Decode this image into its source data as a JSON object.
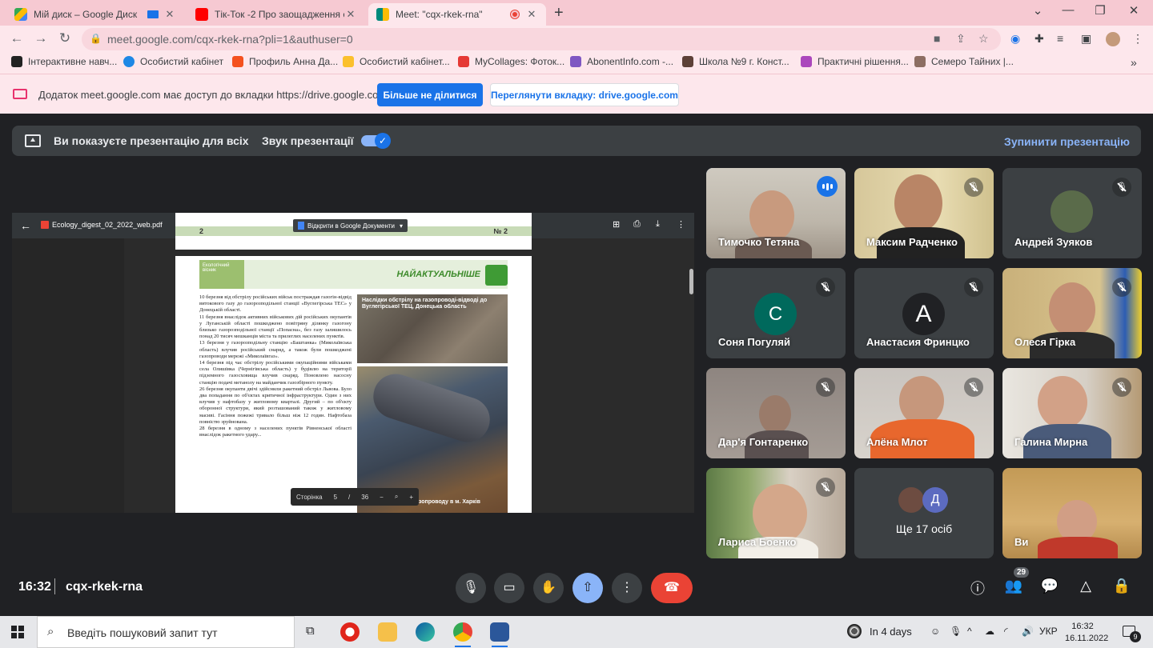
{
  "browser": {
    "tabs": [
      {
        "title": "Мій диск – Google Диск",
        "color": "#4285f4"
      },
      {
        "title": "Tік-Ток -2 Про заощадження ел",
        "color": "#ff0000"
      },
      {
        "title": "Meet: \"cqx-rkek-rna\"",
        "color": "#00897b"
      }
    ],
    "url": "meet.google.com/cqx-rkek-rna?pli=1&authuser=0",
    "bookmarks": [
      "Інтерактивне навч...",
      "Особистий кабінет",
      "Профиль Анна Да...",
      "Особистий кабінет...",
      "MyCollages: Фоток...",
      "AbonentInfo.com -...",
      "Школа №9 г. Конст...",
      "Практичні рішення...",
      "Семеро Тайних |..."
    ]
  },
  "infobar": {
    "message": "Додаток meet.google.com має доступ до вкладки https://drive.google.com",
    "stop_label": "Більше не ділитися",
    "view_label": "Переглянути вкладку: drive.google.com"
  },
  "presbar": {
    "presenting": "Ви показуєте презентацію для всіх",
    "sound": "Звук презентації",
    "stop": "Зупинити презентацію"
  },
  "pdf": {
    "filename": "Ecology_digest_02_2022_web.pdf",
    "open_docs": "Відкрити в Google Документи",
    "page_prev_num": "2",
    "page_prev_label": "№ 2",
    "section_title": "НАЙАКТУАЛЬНІШЕ",
    "logo_text": "Екологічний вісник",
    "photo1_caption": "Наслідки обстрілу на газопроводі-відводі до Вуглегірської ТЕЦ, Донецька область",
    "photo2_caption": "газопроводу в м. Харків",
    "zoom_page_label": "Сторінка",
    "zoom_page_current": "5",
    "zoom_page_sep": "/",
    "zoom_page_total": "36",
    "paragraphs": [
      "10 березня від обстрілу російських військ постраждав газогін-відвід витокового газу до газорозподільної станції «Вуглегірська ТЕС» у Донецькій області.",
      "11 березня внаслідок активних військових дій російських окупантів у Луганській області пошкоджено повітряну ділянку газогону близько газорозподільної станції «Попасна», без газу залишилось понад 20 тисяч мешканців міста та прилеглих населених пунктів.",
      "13 березня у газорозподільну станцію «Баштанка» (Миколаївська область) влучив російський снаряд, а також були пошкоджені газопроводи мережі «Миколаївгаз».",
      "14 березня під час обстрілу російськими окупаційними військами села Олишівка (Чернігівська область) у будівлю на території підземного газосховища влучив снаряд. Поновлено насосну станцію подачі метанолу на майданчик газозбірного пункту.",
      "26 березня окупанти двічі здійснили ракетний обстріл Львова. Було два попадання по об'єктах критичної інфраструктури. Один з них влучив у нафтобазу у житловому кварталі. Другий – по об'єкту оборонної структури, який розташований також у житловому масиві. Гасіння пожежі тривало більш ніж 12 годин. Нафтобаза повністю зруйнована.",
      "28 березня в одному з населених пунктів Рівненської області внаслідок ракетного удару..."
    ]
  },
  "participants": [
    {
      "name": "Тимочко Тетяна",
      "speaking": true
    },
    {
      "name": "Максим Радченко",
      "muted": true
    },
    {
      "name": "Андрей Зуяков",
      "muted": true
    },
    {
      "name": "Соня Погуляй",
      "muted": true,
      "initial": "С",
      "color": "#00695c"
    },
    {
      "name": "Анастасия Фринцко",
      "muted": true,
      "initial": "A",
      "color": "#202124"
    },
    {
      "name": "Олеся Гірка",
      "muted": true
    },
    {
      "name": "Дар'я Гонтаренко",
      "muted": true
    },
    {
      "name": "Алёна Млот",
      "muted": true
    },
    {
      "name": "Галина Мирна",
      "muted": true
    },
    {
      "name": "Лариса Боенко",
      "muted": true
    },
    {
      "name": "Ще 17 осіб",
      "initial": "Д"
    },
    {
      "name": "Ви"
    }
  ],
  "meeting": {
    "time": "16:32",
    "code": "cqx-rkek-rna",
    "participant_count": "29"
  },
  "taskbar": {
    "search_placeholder": "Введіть пошуковий запит тут",
    "weather": "In 4 days",
    "lang": "УКР",
    "time": "16:32",
    "date": "16.11.2022",
    "notifications": "9"
  }
}
